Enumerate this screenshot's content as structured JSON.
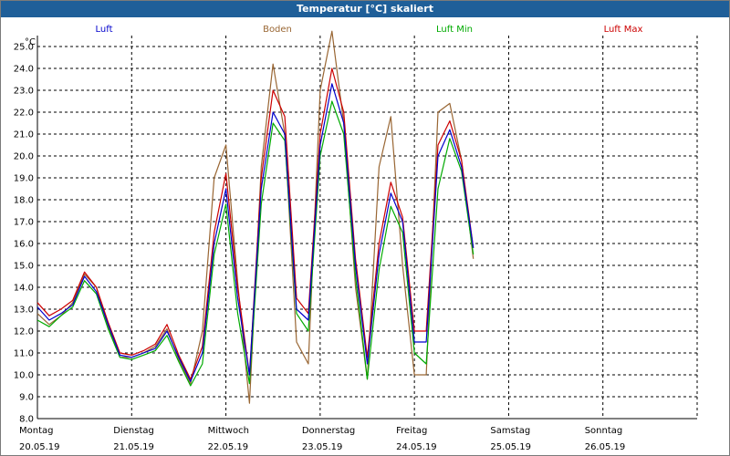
{
  "window": {
    "title": "Temperatur [°C] skaliert"
  },
  "chart_data": {
    "type": "line",
    "title": "Temperatur [°C] skaliert",
    "ylabel": "°C",
    "ylim": [
      8.0,
      25.5
    ],
    "yticks": [
      8.0,
      9.0,
      10.0,
      11.0,
      12.0,
      13.0,
      14.0,
      15.0,
      16.0,
      17.0,
      18.0,
      19.0,
      20.0,
      21.0,
      22.0,
      23.0,
      24.0,
      25.0
    ],
    "grid": true,
    "legend_position": "top",
    "x_days": [
      {
        "day": "Montag",
        "date": "20.05.19"
      },
      {
        "day": "Dienstag",
        "date": "21.05.19"
      },
      {
        "day": "Mittwoch",
        "date": "22.05.19"
      },
      {
        "day": "Donnerstag",
        "date": "23.05.19"
      },
      {
        "day": "Freitag",
        "date": "24.05.19"
      },
      {
        "day": "Samstag",
        "date": "25.05.19"
      },
      {
        "day": "Sonntag",
        "date": "26.05.19"
      }
    ],
    "x_step_days": 0.125,
    "series": [
      {
        "name": "Luft",
        "color": "#0000cc",
        "values": [
          13.1,
          12.5,
          12.8,
          13.2,
          14.5,
          13.8,
          12.3,
          10.9,
          10.8,
          11.0,
          11.2,
          12.0,
          10.8,
          9.7,
          11.0,
          16.0,
          18.5,
          13.5,
          10.0,
          18.5,
          22.0,
          21.0,
          13.0,
          12.5,
          20.5,
          23.3,
          21.5,
          15.0,
          10.5,
          15.5,
          18.3,
          17.0,
          11.5,
          11.5,
          20.0,
          21.2,
          19.5,
          15.8
        ]
      },
      {
        "name": "Boden",
        "color": "#996633",
        "values": [
          12.8,
          12.3,
          12.7,
          13.3,
          14.6,
          14.0,
          12.2,
          10.8,
          10.8,
          11.0,
          11.3,
          12.1,
          10.7,
          9.6,
          12.0,
          19.0,
          20.5,
          14.2,
          8.7,
          19.5,
          24.2,
          21.0,
          11.5,
          10.5,
          23.0,
          25.7,
          21.5,
          14.0,
          9.8,
          19.5,
          21.8,
          15.0,
          10.0,
          10.0,
          22.0,
          22.4,
          19.8,
          15.3
        ]
      },
      {
        "name": "Luft Min",
        "color": "#00aa00",
        "values": [
          12.5,
          12.2,
          12.7,
          13.1,
          14.3,
          13.7,
          12.1,
          10.8,
          10.7,
          10.9,
          11.1,
          11.8,
          10.6,
          9.5,
          10.5,
          15.5,
          17.8,
          12.8,
          9.6,
          17.8,
          21.5,
          20.7,
          12.8,
          12.0,
          20.0,
          22.5,
          21.0,
          14.5,
          9.8,
          14.8,
          17.7,
          16.5,
          11.0,
          10.5,
          18.5,
          20.8,
          19.3,
          15.5
        ]
      },
      {
        "name": "Luft Max",
        "color": "#cc0000",
        "values": [
          13.3,
          12.7,
          13.0,
          13.4,
          14.7,
          14.0,
          12.4,
          11.0,
          10.9,
          11.1,
          11.4,
          12.3,
          10.9,
          9.8,
          11.3,
          16.5,
          19.2,
          14.0,
          10.0,
          19.0,
          23.0,
          21.8,
          13.5,
          12.8,
          21.0,
          24.0,
          22.0,
          15.3,
          10.8,
          16.0,
          18.8,
          17.2,
          12.0,
          12.0,
          20.5,
          21.6,
          19.8,
          15.8
        ]
      }
    ]
  }
}
